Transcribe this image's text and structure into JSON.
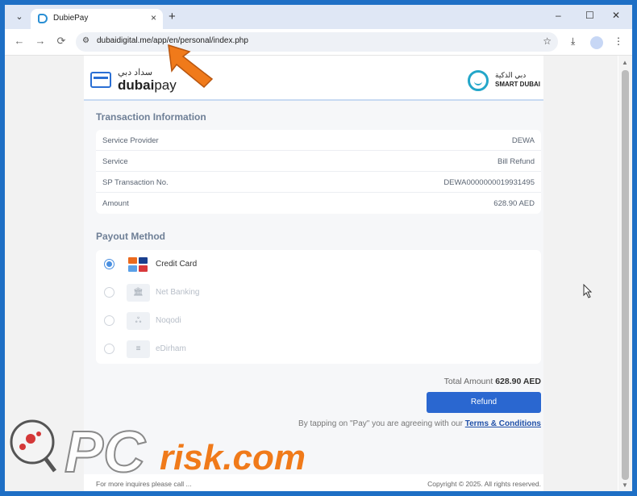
{
  "browser": {
    "tab": {
      "title": "DubiePay",
      "close_glyph": "×"
    },
    "new_tab_glyph": "+",
    "window_controls": {
      "minimize": "–",
      "maximize": "☐",
      "close": "✕"
    },
    "nav": {
      "back": "←",
      "forward": "→",
      "reload": "⟳"
    },
    "address": {
      "url": "dubaidigital.me/app/en/personal/index.php"
    },
    "star_glyph": "☆",
    "download_glyph": "⤓",
    "menu_glyph": "⋮"
  },
  "header": {
    "dubaipay_arabic": "سداد دبي",
    "dubaipay_bold": "dubai",
    "dubaipay_light": "pay",
    "smartdubai_arabic": "دبي الذكية",
    "smartdubai_name": "SMART DUBAI"
  },
  "transaction": {
    "title": "Transaction Information",
    "rows": [
      {
        "label": "Service Provider",
        "value": "DEWA"
      },
      {
        "label": "Service",
        "value": "Bill Refund"
      },
      {
        "label": "SP Transaction No.",
        "value": "DEWA0000000019931495"
      },
      {
        "label": "Amount",
        "value": "628.90 AED"
      }
    ]
  },
  "payout": {
    "title": "Payout Method",
    "methods": [
      {
        "label": "Credit Card",
        "selected": true,
        "icon": "credit-card-icon"
      },
      {
        "label": "Net Banking",
        "selected": false,
        "icon": "bank-icon"
      },
      {
        "label": "Noqodi",
        "selected": false,
        "icon": "noqodi-icon"
      },
      {
        "label": "eDirham",
        "selected": false,
        "icon": "edirham-icon"
      }
    ]
  },
  "summary": {
    "total_label": "Total Amount",
    "total_value": "628.90 AED",
    "button_label": "Refund",
    "terms_prefix": "By tapping on \"Pay\" you are agreeing with our",
    "terms_link": "Terms & Conditions"
  },
  "footer": {
    "left": "For more inquires please call ...",
    "right": "Copyright © 2025. All rights reserved."
  },
  "watermark": {
    "text": "risk.com",
    "pc": "PC"
  },
  "colors": {
    "accent": "#2a67d0",
    "section_title": "#6e7f96",
    "arrow": "#f07a1a",
    "frame": "#1e6fc5"
  }
}
